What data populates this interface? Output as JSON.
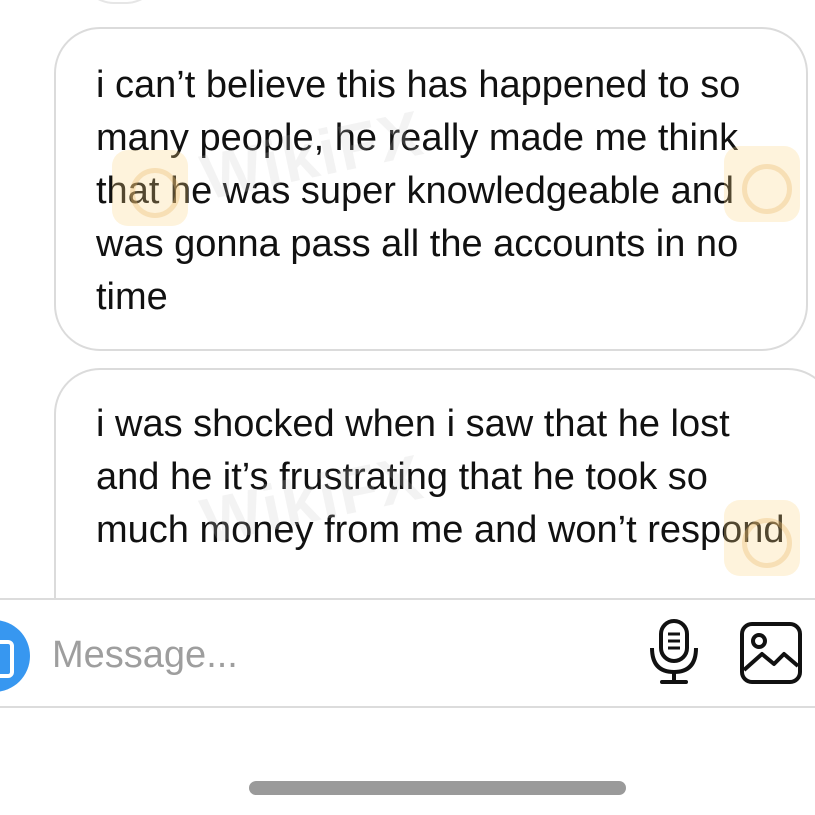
{
  "conversation": {
    "messages": [
      {
        "text": "i can’t believe this has happened to so many people, he really made me think that he was super knowledgeable and was gonna pass all the accounts in no time"
      },
      {
        "text": "i was shocked when i saw that he lost and he it’s frustrating that he took so much money from me and won’t respond"
      }
    ]
  },
  "composer": {
    "placeholder": "Message...",
    "camera_icon": "camera-icon",
    "mic_icon": "microphone-icon",
    "image_icon": "image-gallery-icon"
  },
  "watermark": {
    "brand": "WikiFX"
  },
  "colors": {
    "accent": "#3797f0",
    "bubble_border": "#dbdbdb",
    "placeholder": "#9e9e9e"
  }
}
